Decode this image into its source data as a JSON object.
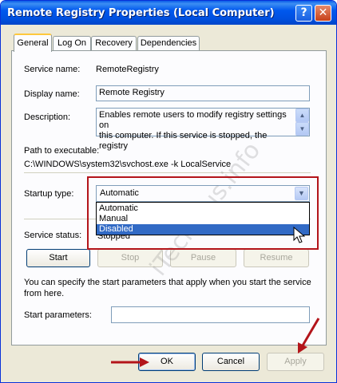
{
  "window": {
    "title": "Remote Registry Properties (Local Computer)",
    "help_glyph": "?",
    "close_glyph": "✕"
  },
  "tabs": [
    {
      "label": "General"
    },
    {
      "label": "Log On"
    },
    {
      "label": "Recovery"
    },
    {
      "label": "Dependencies"
    }
  ],
  "general": {
    "service_name_label": "Service name:",
    "service_name_value": "RemoteRegistry",
    "display_name_label": "Display name:",
    "display_name_value": "Remote Registry",
    "description_label": "Description:",
    "description_value": "Enables remote users to modify registry settings on\nthis computer. If this service is stopped, the registry",
    "path_label": "Path to executable:",
    "path_value": "C:\\WINDOWS\\system32\\svchost.exe -k LocalService",
    "startup_type_label": "Startup type:",
    "startup_type_value": "Automatic",
    "startup_options": [
      "Automatic",
      "Manual",
      "Disabled"
    ],
    "selected_option_index": 2,
    "service_status_label": "Service status:",
    "service_status_value": "Stopped",
    "buttons": {
      "start": "Start",
      "stop": "Stop",
      "pause": "Pause",
      "resume": "Resume"
    },
    "info_text": "You can specify the start parameters that apply when you start the service from here.",
    "start_params_label": "Start parameters:",
    "start_params_value": ""
  },
  "footer": {
    "ok": "OK",
    "cancel": "Cancel",
    "apply": "Apply"
  },
  "watermark": "iTechPlus.info",
  "colors": {
    "title_bar": "#0050e0",
    "annotation_red": "#b3141a",
    "selection": "#316ac5"
  }
}
